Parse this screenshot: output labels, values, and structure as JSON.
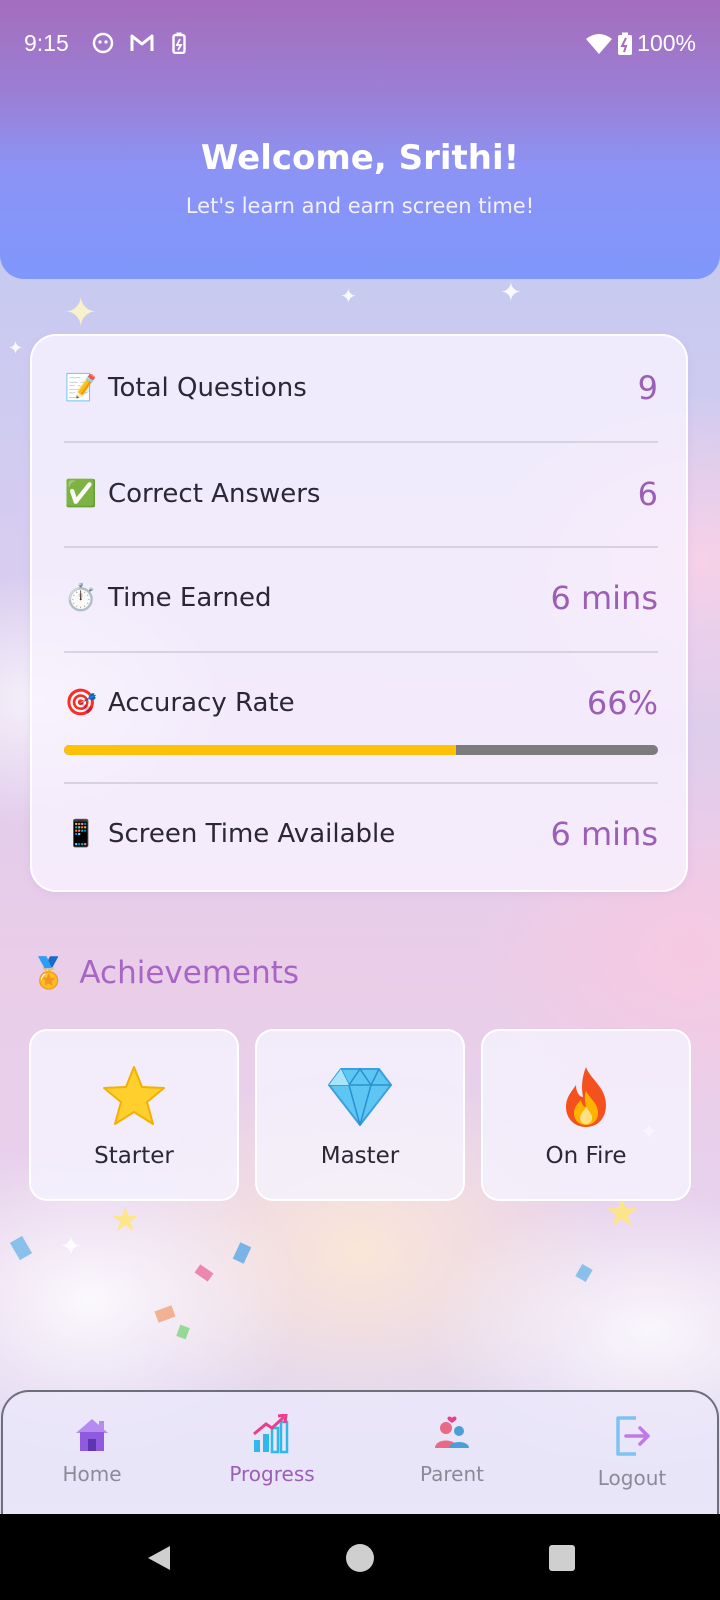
{
  "status_bar": {
    "time": "9:15",
    "battery": "100%"
  },
  "header": {
    "welcome": "Welcome, Srithi!",
    "subtitle": "Let's learn and earn screen time!"
  },
  "stats": {
    "rows": [
      {
        "emoji": "📝",
        "label": "Total Questions",
        "value": "9"
      },
      {
        "emoji": "✅",
        "label": "Correct Answers",
        "value": "6"
      },
      {
        "emoji": "⏱️",
        "label": "Time Earned",
        "value": "6 mins"
      },
      {
        "emoji": "🎯",
        "label": "Accuracy Rate",
        "value": "66%"
      },
      {
        "emoji": "📱",
        "label": "Screen Time Available",
        "value": "6 mins"
      }
    ],
    "accuracy_fraction": 0.66,
    "accent_color": "#9c5fb6",
    "progress_color": "#ffc107"
  },
  "achievements": {
    "emoji": "🏅",
    "title": "Achievements",
    "items": [
      {
        "icon": "star-icon",
        "label": "Starter"
      },
      {
        "icon": "diamond-icon",
        "label": "Master"
      },
      {
        "icon": "fire-icon",
        "label": "On Fire"
      }
    ]
  },
  "bottom_nav": {
    "items": [
      {
        "icon": "home-icon",
        "label": "Home",
        "active": false
      },
      {
        "icon": "progress-chart-icon",
        "label": "Progress",
        "active": true
      },
      {
        "icon": "parent-icon",
        "label": "Parent",
        "active": false
      },
      {
        "icon": "logout-icon",
        "label": "Logout",
        "active": false
      }
    ]
  }
}
